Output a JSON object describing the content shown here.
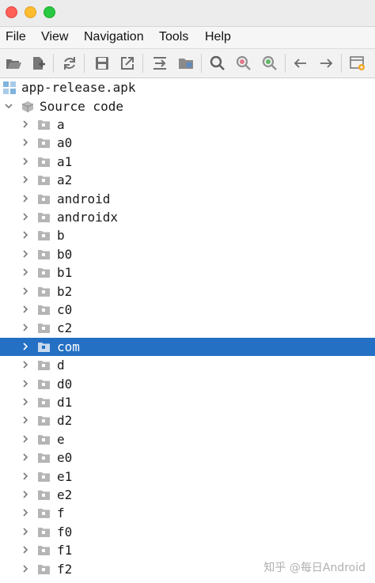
{
  "menu": [
    "File",
    "View",
    "Navigation",
    "Tools",
    "Help"
  ],
  "toolbar_icons": [
    "open-file-icon",
    "add-files-icon",
    "sync-icon",
    "save-icon",
    "export-icon",
    "decompile-icon",
    "folder-icon",
    "search-icon",
    "search-class-icon",
    "search-usage-icon",
    "back-icon",
    "forward-icon",
    "preferences-icon"
  ],
  "tree": {
    "root_label": "app-release.apk",
    "source_label": "Source code",
    "packages": [
      "a",
      "a0",
      "a1",
      "a2",
      "android",
      "androidx",
      "b",
      "b0",
      "b1",
      "b2",
      "c0",
      "c2",
      "com",
      "d",
      "d0",
      "d1",
      "d2",
      "e",
      "e0",
      "e1",
      "e2",
      "f",
      "f0",
      "f1",
      "f2"
    ],
    "selected": "com"
  },
  "colors": {
    "selection": "#2470c4",
    "close": "#fe5f57",
    "minimize": "#febc2e",
    "maximize": "#28c840"
  },
  "watermark": "知乎 @每日Android"
}
